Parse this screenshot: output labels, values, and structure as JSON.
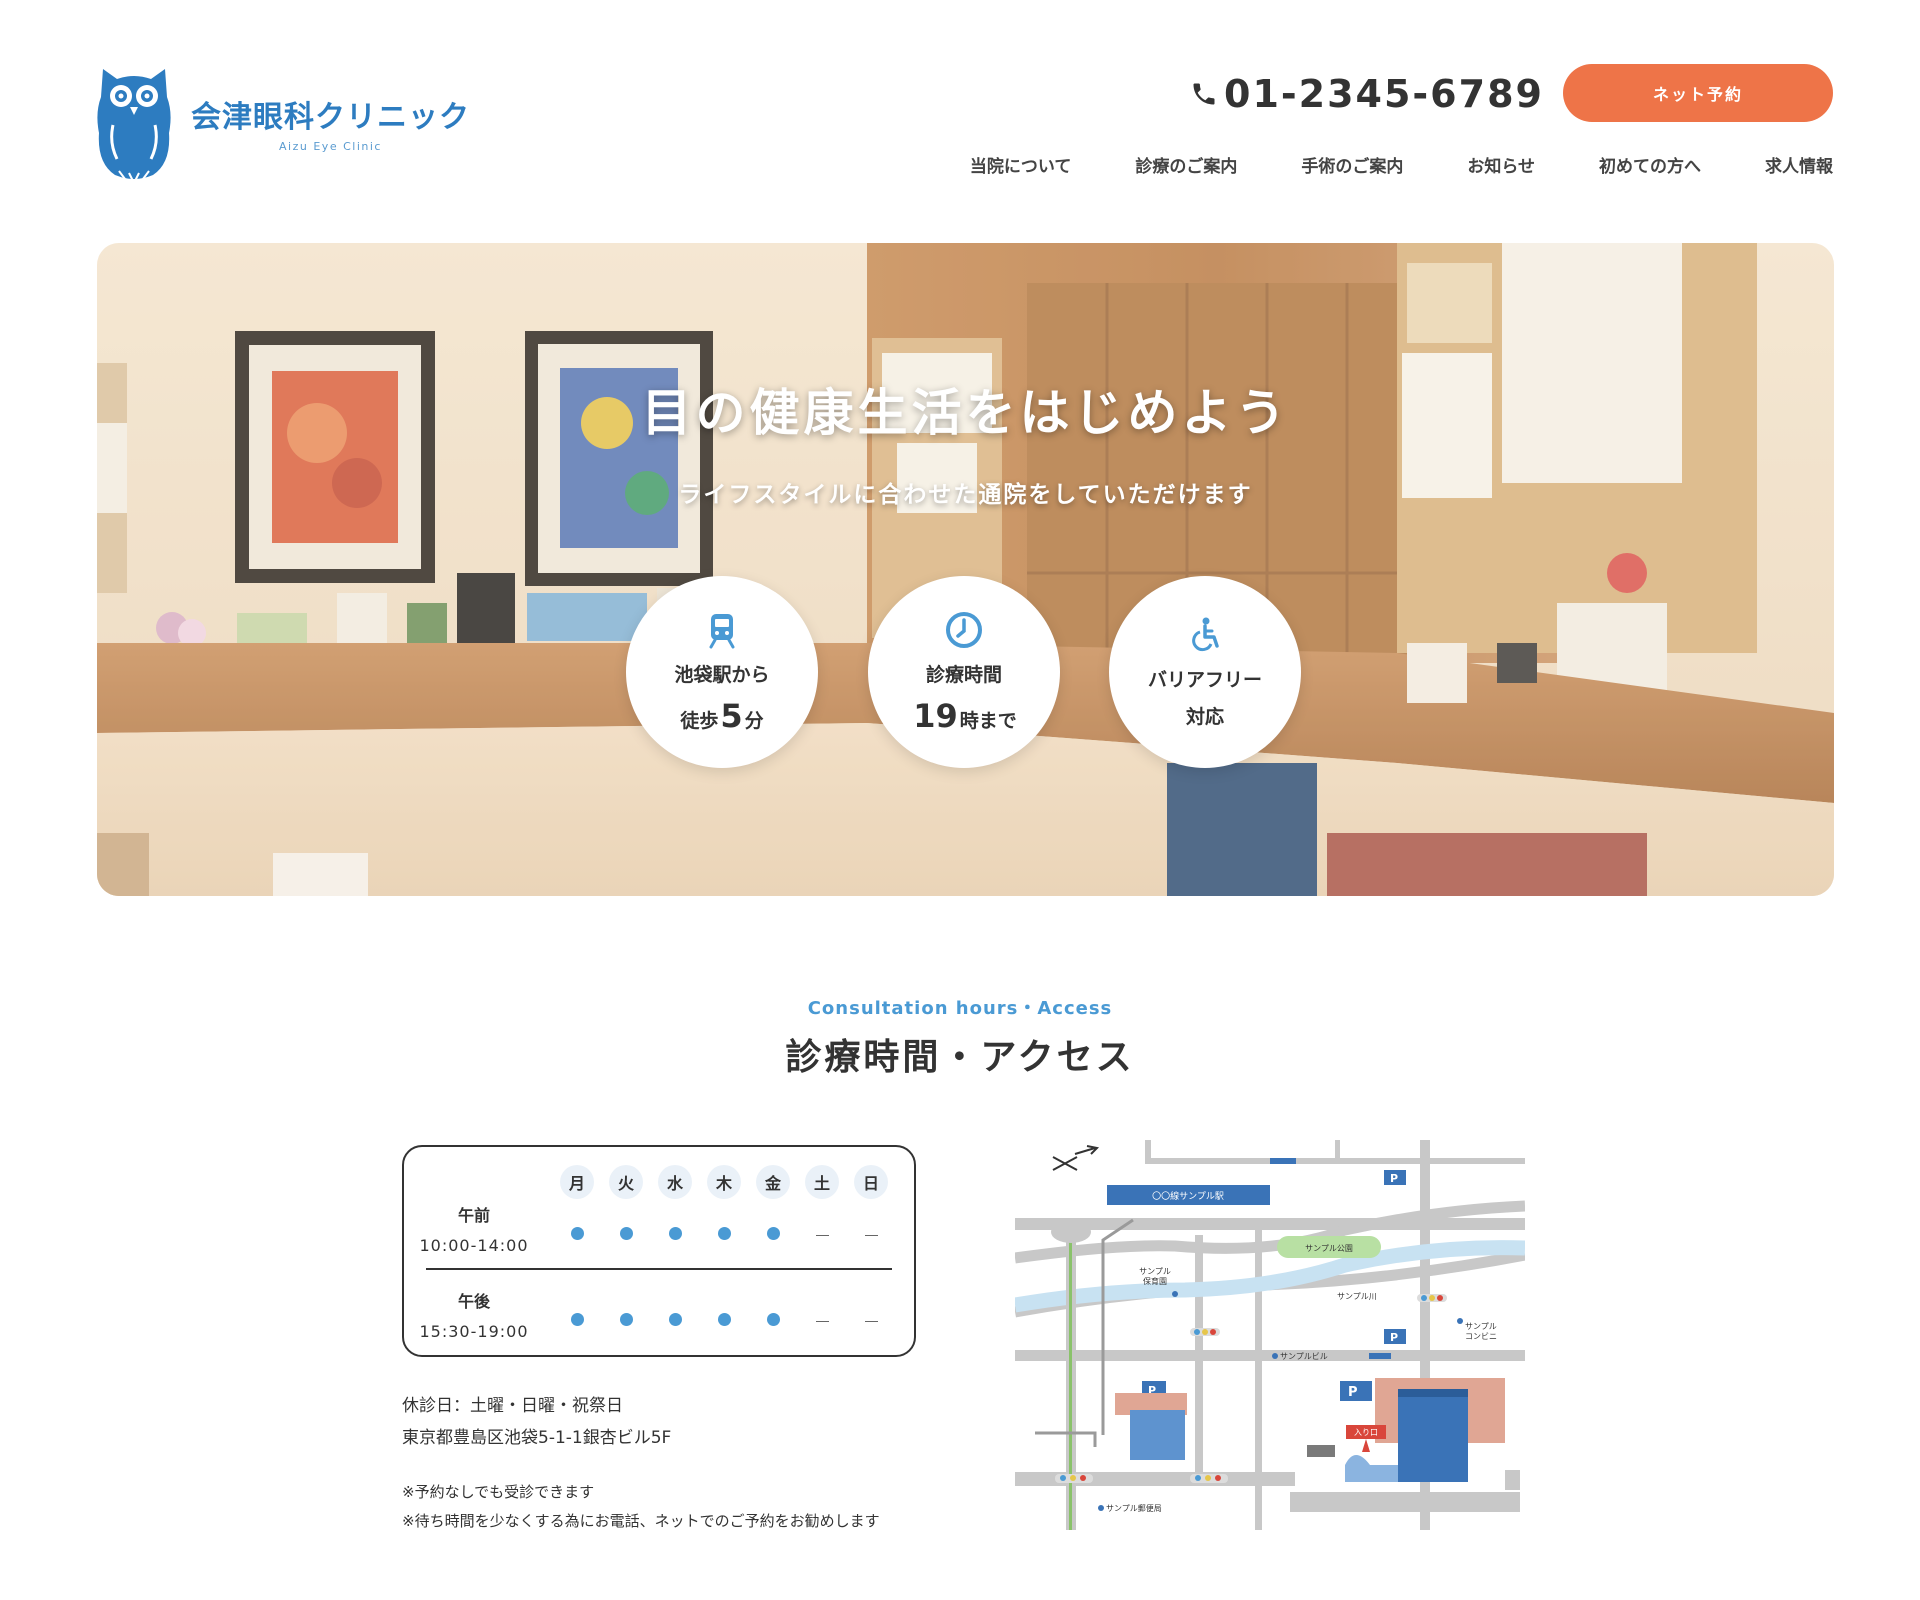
{
  "header": {
    "logo_name": "会津眼科クリニック",
    "logo_sub": "Aizu Eye Clinic",
    "phone": "01-2345-6789",
    "reserve_label": "ネット予約",
    "nav": [
      "当院について",
      "診療のご案内",
      "手術のご案内",
      "お知らせ",
      "初めての方へ",
      "求人情報"
    ]
  },
  "hero": {
    "title": "目の健康生活をはじめよう",
    "subtitle": "ライフスタイルに合わせた通院をしていただけます",
    "features": [
      {
        "icon": "train-icon",
        "line1": "池袋駅から",
        "pre": "徒歩",
        "big": "5",
        "post": "分"
      },
      {
        "icon": "clock-icon",
        "line1": "診療時間",
        "pre": "",
        "big": "19",
        "post": "時まで"
      },
      {
        "icon": "wheelchair-icon",
        "line1": "バリアフリー",
        "pre": "対応",
        "big": "",
        "post": ""
      }
    ]
  },
  "section": {
    "en": "Consultation hours・Access",
    "jp": "診療時間・アクセス"
  },
  "schedule": {
    "days": [
      "月",
      "火",
      "水",
      "木",
      "金",
      "土",
      "日"
    ],
    "slots": [
      {
        "name": "午前",
        "time": "10:00-14:00",
        "open": [
          true,
          true,
          true,
          true,
          true,
          false,
          false
        ]
      },
      {
        "name": "午後",
        "time": "15:30-19:00",
        "open": [
          true,
          true,
          true,
          true,
          true,
          false,
          false
        ]
      }
    ],
    "closed": "休診日：土曜・日曜・祝祭日",
    "address": "東京都豊島区池袋5-1-1銀杏ビル5F",
    "note1": "※予約なしでも受診できます",
    "note2": "※待ち時間を少なくする為にお電話、ネットでのご予約をお勧めします"
  },
  "map": {
    "station": "〇〇線サンプル駅",
    "park": "サンプル公園",
    "nursery_1": "サンプル",
    "nursery_2": "保育園",
    "river": "サンプル川",
    "building": "サンプルビル",
    "convenience_1": "サンプル",
    "convenience_2": "コンビニ",
    "post_office": "サンプル郵便局",
    "entrance": "入り口",
    "parking": "P"
  },
  "colors": {
    "brand_blue": "#2d7cc0",
    "accent_orange": "#ee7448",
    "dot_blue": "#4a9ad4"
  }
}
